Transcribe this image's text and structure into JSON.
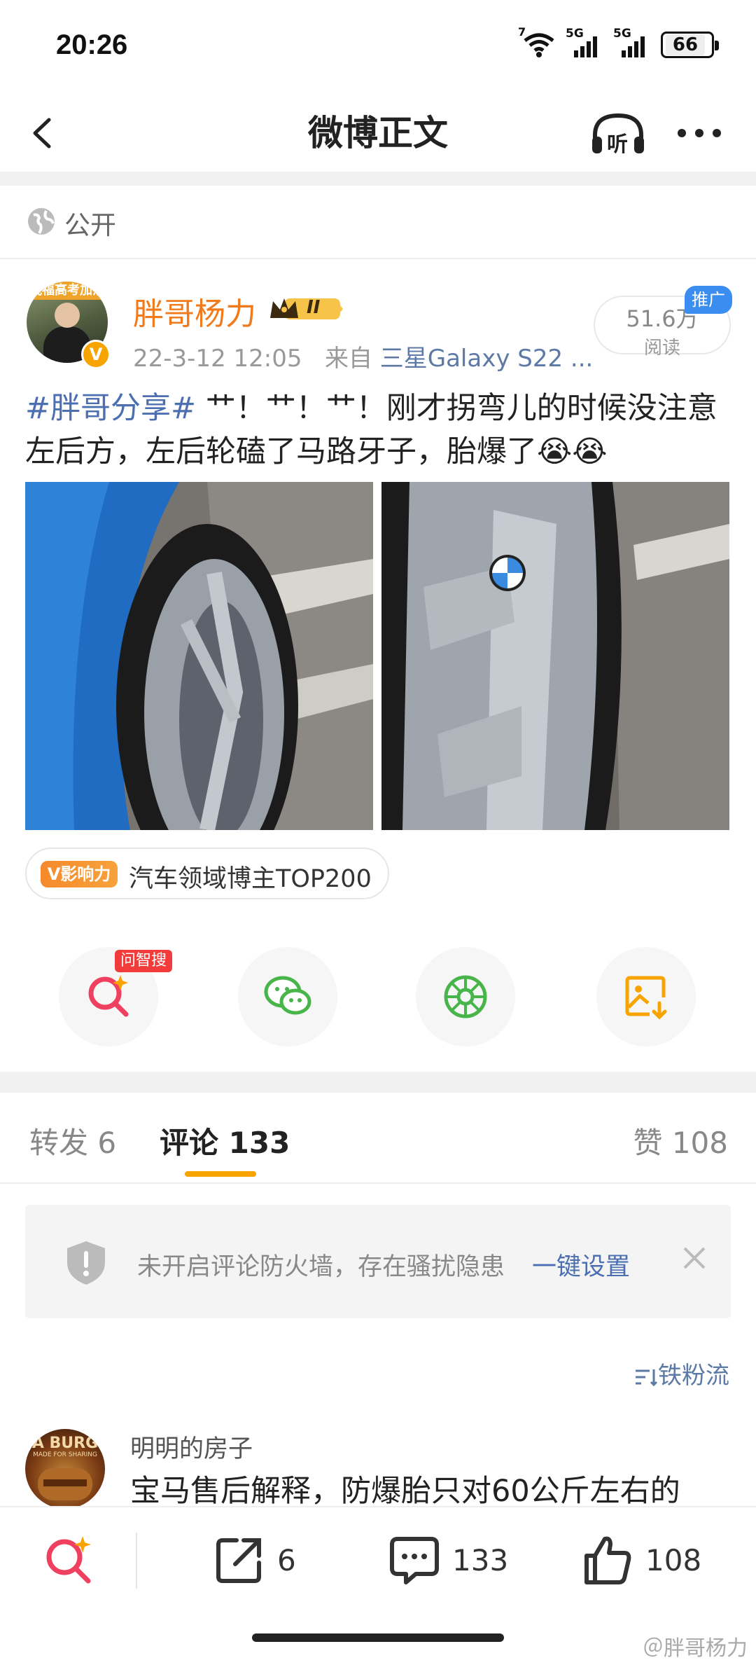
{
  "status_bar": {
    "time": "20:26",
    "battery": "66",
    "signal1": "5G",
    "signal2": "5G",
    "wifi_badge": "7"
  },
  "nav": {
    "title": "微博正文",
    "listen_label": "听"
  },
  "visibility": {
    "label": "公开"
  },
  "author": {
    "name": "胖哥杨力",
    "level_badge": "II",
    "avatar_caption": "祝福高考加油",
    "date": "22-3-12 12:05",
    "source_prefix": "来自",
    "source": "三星Galaxy S22 ...",
    "verified_mark": "V"
  },
  "reads": {
    "count": "51.6万",
    "label": "阅读",
    "promo": "推广"
  },
  "post": {
    "hashtag": "#胖哥分享#",
    "text": " 艹！艹！艹！刚才拐弯儿的时候没注意左后方，左后轮磕了马路牙子，胎爆了😭😭"
  },
  "photos": [
    {
      "alt": "blue car rear wheel scraped rim"
    },
    {
      "alt": "close-up scraped BMW rim with PILOT tire"
    }
  ],
  "influence": {
    "badge": "V影响力",
    "text": "汽车领域博主TOP200"
  },
  "share": {
    "ask_tag": "问智搜"
  },
  "tabs": [
    {
      "label": "转发",
      "count": "6"
    },
    {
      "label": "评论",
      "count": "133"
    },
    {
      "label": "赞",
      "count": "108"
    }
  ],
  "firewall": {
    "text": "未开启评论防火墙，存在骚扰隐患",
    "link": "一键设置"
  },
  "sort": {
    "label": "铁粉流"
  },
  "comment": {
    "avatar_caption": "A BURG",
    "avatar_sub": "MADE FOR SHARING",
    "name": "明明的房子",
    "text": "宝马售后解释，防爆胎只对60公斤左右的"
  },
  "bottom_bar": {
    "reposts": "6",
    "comments": "133",
    "likes": "108"
  },
  "watermark": "＠胖哥杨力",
  "colors": {
    "accent_orange": "#f7a300",
    "link_blue": "#4b6fb0",
    "username": "#f07a1c"
  }
}
